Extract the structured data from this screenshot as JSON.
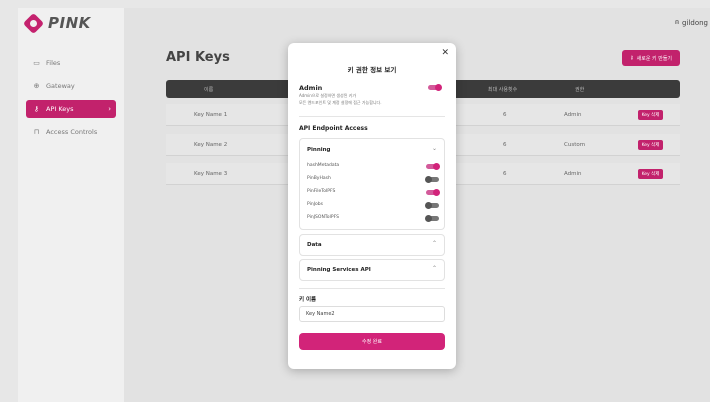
{
  "app": {
    "logo_text": "PINK"
  },
  "sidebar": {
    "items": [
      {
        "label": "Files",
        "icon": "file-icon",
        "active": false
      },
      {
        "label": "Gateway",
        "icon": "gateway-icon",
        "active": false
      },
      {
        "label": "API Keys",
        "icon": "key-icon",
        "active": true
      },
      {
        "label": "Access Controls",
        "icon": "lock-icon",
        "active": false
      }
    ]
  },
  "header": {
    "user": "gildong"
  },
  "main": {
    "title": "API Keys",
    "create_button": "새로운 키 만들기",
    "table": {
      "columns": [
        "이름",
        "최대 사용횟수",
        "권한"
      ],
      "rows": [
        {
          "name": "Key Name 1",
          "uses": "6",
          "role": "Admin",
          "action": "Key 삭제"
        },
        {
          "name": "Key Name 2",
          "uses": "6",
          "role": "Custom",
          "action": "Key 삭제"
        },
        {
          "name": "Key Name 3",
          "uses": "6",
          "role": "Admin",
          "action": "Key 삭제"
        }
      ]
    }
  },
  "modal": {
    "title": "키 권한 정보 보기",
    "admin": {
      "label": "Admin",
      "desc_line1": "Admin으로 설정하면 생성된 키가",
      "desc_line2": "모든 엔드포인트 및 계정 설정에 접근 가능합니다.",
      "enabled": true
    },
    "endpoint_title": "API Endpoint Access",
    "groups": [
      {
        "title": "Pinning",
        "expanded": true,
        "endpoints": [
          {
            "label": "hashMetadata",
            "enabled": true
          },
          {
            "label": "PinByHash",
            "enabled": false
          },
          {
            "label": "PinFileToIPFS",
            "enabled": true
          },
          {
            "label": "PinJobs",
            "enabled": false
          },
          {
            "label": "PinJSONToIPFS",
            "enabled": false
          }
        ]
      },
      {
        "title": "Data",
        "expanded": false
      },
      {
        "title": "Pinning Services API",
        "expanded": false
      }
    ],
    "name_label": "키 이름",
    "name_value": "Key Name2",
    "submit": "수정 완료"
  },
  "colors": {
    "accent": "#c2226c",
    "dark_header": "#3b3b3b"
  }
}
